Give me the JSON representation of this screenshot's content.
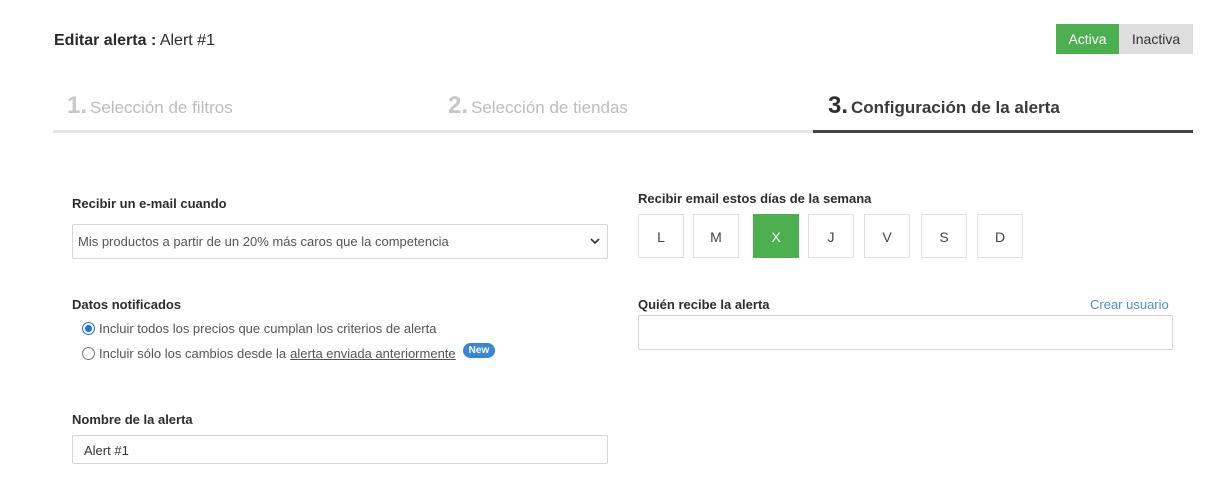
{
  "header": {
    "title_prefix": "Editar alerta",
    "separator": ":",
    "alert_name": "Alert #1"
  },
  "status_toggle": {
    "active_label": "Activa",
    "inactive_label": "Inactiva",
    "selected": "Activa"
  },
  "steps": [
    {
      "number": "1.",
      "label": "Selección de filtros"
    },
    {
      "number": "2.",
      "label": "Selección de tiendas"
    },
    {
      "number": "3.",
      "label": "Configuración de la alerta"
    }
  ],
  "email_when": {
    "label": "Recibir un e-mail cuando",
    "selected_option": "Mis productos a partir de un 20% más caros que la competencia"
  },
  "notified_data": {
    "label": "Datos notificados",
    "option_all": "Incluir todos los precios que cumplan los criterios de alerta",
    "option_changes_prefix": "Incluir sólo los cambios desde la",
    "option_changes_link": "alerta enviada anteriormente",
    "new_badge": "New",
    "selected": "all"
  },
  "alert_name_field": {
    "label": "Nombre de la alerta",
    "value": "Alert #1"
  },
  "week_days": {
    "label": "Recibir email estos días de la semana",
    "days": [
      "L",
      "M",
      "X",
      "J",
      "V",
      "S",
      "D"
    ],
    "selected": [
      "X"
    ]
  },
  "recipients": {
    "label": "Quién recibe la alerta",
    "create_user_link": "Crear usuario",
    "value": ""
  },
  "colors": {
    "accent_green": "#4caf50",
    "link_blue": "#4a90d9",
    "badge_blue": "#3a86d6"
  }
}
